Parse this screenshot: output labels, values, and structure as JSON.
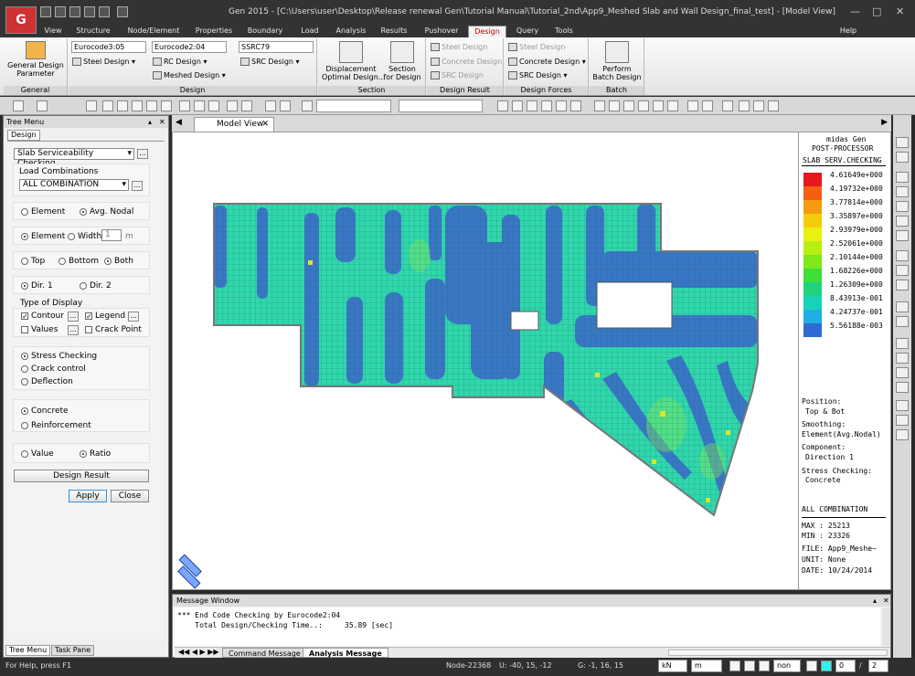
{
  "window": {
    "title": "Gen 2015 - [C:\\Users\\user\\Desktop\\Release renewal Gen\\Tutorial Manual\\Tutorial_2nd\\App9_Meshed Slab and Wall Design_final_test] - [Model View]",
    "help": "Help"
  },
  "menu": [
    "View",
    "Structure",
    "Node/Element",
    "Properties",
    "Boundary",
    "Load",
    "Analysis",
    "Results",
    "Pushover",
    "Design",
    "Query",
    "Tools"
  ],
  "ribbon": {
    "general_design": "General Design\nParameter",
    "code1": "Eurocode3:05",
    "code2": "Eurocode2:04",
    "code3": "SSRC79",
    "steel_design": "Steel Design",
    "rc_design": "RC Design",
    "meshed_design": "Meshed Design",
    "src_design": "SRC Design",
    "displacement": "Displacement\nOptimal Design...",
    "section": "Section\nfor Design",
    "res_steel": "Steel Design",
    "res_concrete": "Concrete Design",
    "res_src": "SRC Design",
    "f_steel": "Steel Design",
    "f_concrete": "Concrete Design",
    "f_src": "SRC Design",
    "batch": "Perform\nBatch Design",
    "groups": {
      "general": "General",
      "design": "Design",
      "section": "Section",
      "result": "Design Result",
      "forces": "Design Forces",
      "batch": "Batch"
    }
  },
  "tree": {
    "title": "Tree Menu",
    "tab": "Design",
    "function": "Slab Serviceability Checking",
    "load_comb_label": "Load Combinations",
    "load_comb": "ALL COMBINATION",
    "element": "Element",
    "avg_nodal": "Avg. Nodal",
    "element2": "Element",
    "width": "Width",
    "width_val": "1",
    "width_unit": "m",
    "top": "Top",
    "bottom": "Bottom",
    "both": "Both",
    "dir1": "Dir. 1",
    "dir2": "Dir. 2",
    "type_display": "Type of Display",
    "contour": "Contour",
    "legend": "Legend",
    "values": "Values",
    "crack_point": "Crack Point",
    "stress": "Stress Checking",
    "crack": "Crack control",
    "deflection": "Deflection",
    "concrete": "Concrete",
    "reinforcement": "Reinforcement",
    "value": "Value",
    "ratio": "Ratio",
    "design_result": "Design Result",
    "apply": "Apply",
    "close": "Close",
    "bottom_tab1": "Tree Menu",
    "bottom_tab2": "Task Pane"
  },
  "view_tab": "Model View",
  "legend": {
    "header1": "midas Gen",
    "header2": "POST-PROCESSOR",
    "header3": "SLAB SERV.CHECKING",
    "levels": [
      {
        "v": "4.61649e+000",
        "c": "#e8191c"
      },
      {
        "v": "4.19732e+000",
        "c": "#f45f14"
      },
      {
        "v": "3.77814e+000",
        "c": "#f89b10"
      },
      {
        "v": "3.35897e+000",
        "c": "#f4cc0c"
      },
      {
        "v": "2.93979e+000",
        "c": "#e9f10e"
      },
      {
        "v": "2.52061e+000",
        "c": "#b8ef10"
      },
      {
        "v": "2.10144e+000",
        "c": "#7ee81a"
      },
      {
        "v": "1.68226e+000",
        "c": "#3ddf39"
      },
      {
        "v": "1.26309e+000",
        "c": "#21d27c"
      },
      {
        "v": "8.43913e-001",
        "c": "#16d2b9"
      },
      {
        "v": "4.24737e-001",
        "c": "#1eaee4"
      },
      {
        "v": "5.56188e-003",
        "c": "#2f6bd4"
      }
    ],
    "position_lbl": "Position:",
    "position": "Top & Bot",
    "smoothing_lbl": "Smoothing:",
    "smoothing": "Element(Avg.Nodal)",
    "component_lbl": "Component:",
    "component": "Direction 1",
    "stress_lbl": "Stress Checking:",
    "stress": "Concrete",
    "comb": "ALL COMBINATION",
    "max": "MAX : 25213",
    "min": "MIN : 23326",
    "file": "FILE: App9_Meshe~",
    "unit": "UNIT: None",
    "date": "DATE: 10/24/2014"
  },
  "message": {
    "title": "Message Window",
    "line1": "*** End Code Checking by Eurocode2:04",
    "line2": "    Total Design/Checking Time..:     35.89 [sec]",
    "tab1": "Command Message",
    "tab2": "Analysis Message"
  },
  "status": {
    "help": "For Help, press F1",
    "node": "Node-22368",
    "u": "U: -40, 15, -12",
    "g": "G: -1, 16, 15",
    "force_unit": "kN",
    "len_unit": "m",
    "snap": "non",
    "page": "0",
    "pages": "2"
  }
}
